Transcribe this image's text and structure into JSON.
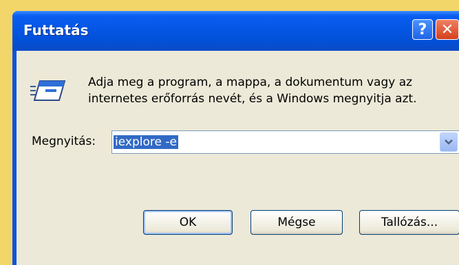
{
  "window": {
    "title": "Futtatás",
    "help_label": "?",
    "close_label": "✕"
  },
  "dialog": {
    "description_line1": "Adja meg a program, a mappa, a dokumentum vagy az",
    "description_line2": "internetes erőforrás nevét, és a Windows megnyitja azt.",
    "open_label": "Megnyitás:",
    "open_value": "iexplore -e"
  },
  "buttons": {
    "ok": "OK",
    "cancel": "Mégse",
    "browse": "Tallózás..."
  },
  "icons": {
    "run": "run-program-icon",
    "dropdown": "chevron-down-icon"
  },
  "colors": {
    "titlebar": "#0456e4",
    "dialog_bg": "#ece9d8",
    "selection": "#316ac5",
    "close": "#d3401e"
  }
}
